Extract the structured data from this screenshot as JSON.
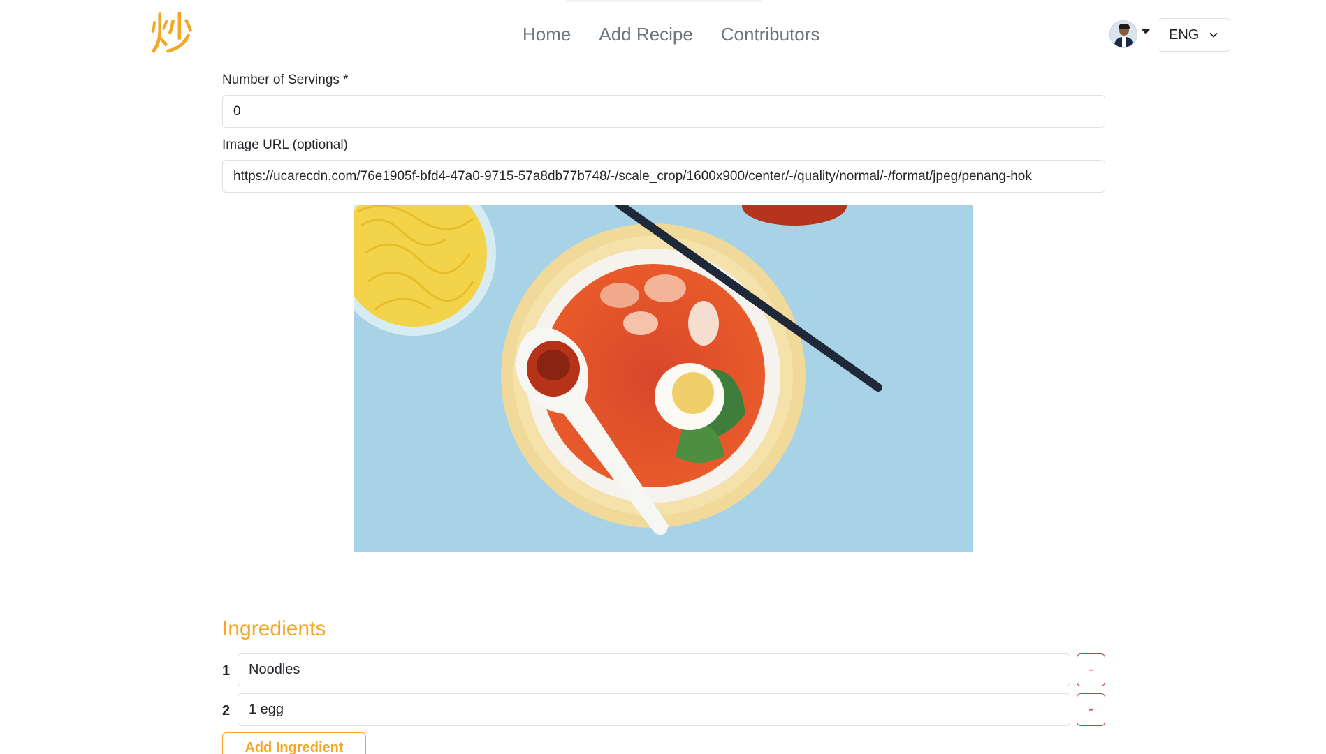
{
  "header": {
    "logo_text": "炒",
    "nav": [
      {
        "label": "Home"
      },
      {
        "label": "Add Recipe"
      },
      {
        "label": "Contributors"
      }
    ],
    "language": "ENG",
    "icons": {
      "avatar": "user-avatar",
      "caret": "caret-down-icon",
      "chevron": "chevron-down-icon"
    }
  },
  "form": {
    "servings": {
      "label": "Number of Servings *",
      "value": "0"
    },
    "image_url": {
      "label": "Image URL (optional)",
      "value": "https://ucarecdn.com/76e1905f-bfd4-47a0-9715-57a8db77b748/-/scale_crop/1600x900/center/-/quality/normal/-/format/jpeg/penang-hok"
    }
  },
  "ingredients": {
    "title": "Ingredients",
    "items": [
      {
        "number": "1",
        "value": "Noodles",
        "remove_label": "-"
      },
      {
        "number": "2",
        "value": "1 egg",
        "remove_label": "-"
      }
    ],
    "add_label": "Add Ingredient"
  },
  "colors": {
    "accent": "#f5a623",
    "danger": "#dc3545",
    "nav_text": "#6c757d",
    "border": "#dee2e6"
  }
}
